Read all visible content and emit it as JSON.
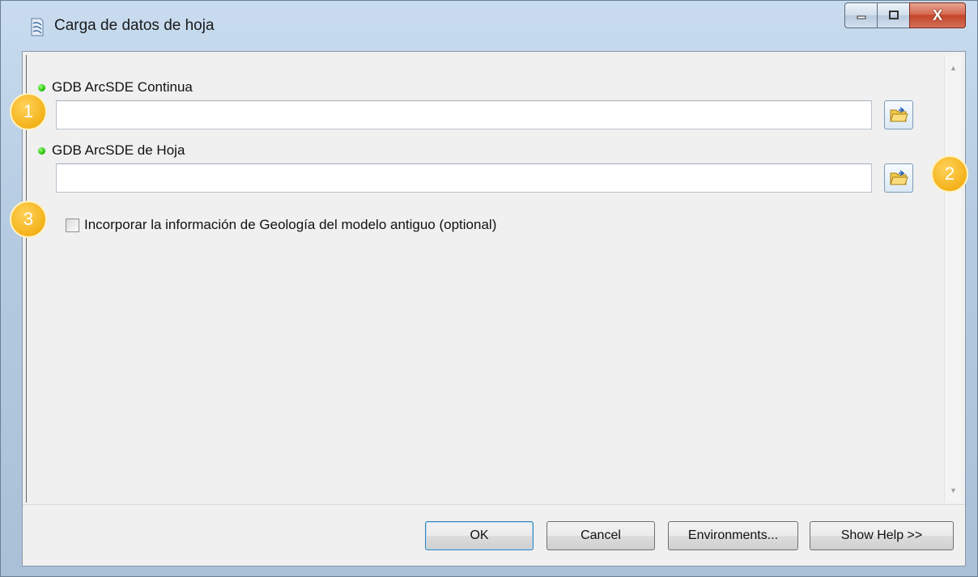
{
  "window": {
    "title": "Carga de datos de hoja",
    "controls": {
      "minimize": "minimize",
      "maximize": "maximize",
      "close": "X"
    }
  },
  "params": [
    {
      "label": "GDB ArcSDE Continua",
      "value": "",
      "required": true
    },
    {
      "label": "GDB ArcSDE de Hoja",
      "value": "",
      "required": true
    }
  ],
  "option": {
    "label": "Incorporar la información de Geología del modelo antiguo (optional)",
    "checked": false
  },
  "buttons": {
    "ok": "OK",
    "cancel": "Cancel",
    "environments": "Environments...",
    "show_help": "Show Help >>"
  },
  "markers": [
    "1",
    "2",
    "3"
  ],
  "colors": {
    "required_dot": "#18b800",
    "marker": "#f4b21a",
    "close_button": "#c4462a"
  }
}
